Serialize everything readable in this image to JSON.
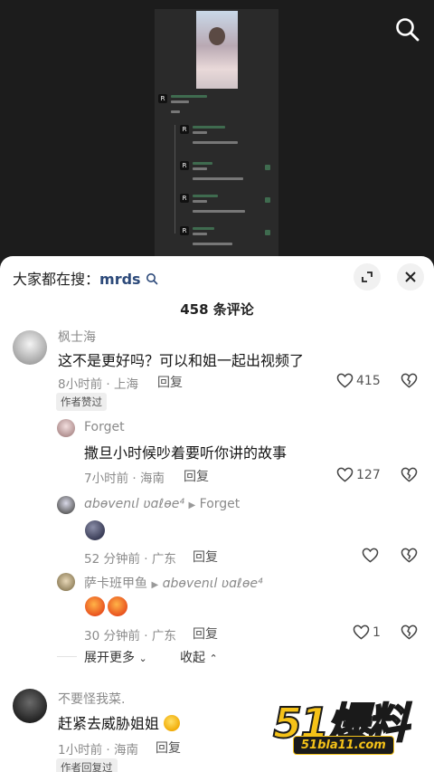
{
  "header": {
    "search_hint_prefix": "大家都在搜：",
    "search_hint_term": "mrds",
    "comment_count": "458 条评论"
  },
  "comments": [
    {
      "user": "枫士海",
      "text": "这不是更好吗？可以和姐一起出视频了",
      "time_loc": "8小时前 · 上海",
      "reply_label": "回复",
      "likes": "415",
      "badge": "作者赞过"
    },
    {
      "user": "Forget",
      "text": "撒旦小时候吵着要听你讲的故事",
      "time_loc": "7小时前 · 海南",
      "reply_label": "回复",
      "likes": "127"
    },
    {
      "user": "ɑbѳvenιl ʋɑℓѳe⁴",
      "reply_to": "Forget",
      "time_loc": "52 分钟前 · 广东",
      "reply_label": "回复",
      "likes": ""
    },
    {
      "user": "萨卡班甲鱼",
      "reply_to": "ɑbѳvenιl ʋɑℓѳe⁴",
      "time_loc": "30 分钟前 · 广东",
      "reply_label": "回复",
      "likes": "1"
    },
    {
      "user": "不要怪我菜.",
      "text": "赶紧去威胁姐姐",
      "time_loc": "1小时前 · 海南",
      "reply_label": "回复",
      "badge": "作者回复过"
    }
  ],
  "thread_controls": {
    "expand_label": "展开更多",
    "collapse_label": "收起"
  },
  "watermark": {
    "big_text": "51爆料",
    "url_text": "51bla11.com"
  },
  "icons": [
    "search-icon",
    "expand-icon",
    "close-icon",
    "heart-icon",
    "broken-heart-icon",
    "triangle-right-icon",
    "chevron-down-icon",
    "chevron-up-icon"
  ],
  "colors": {
    "search_term": "#2d4a7a",
    "watermark_yellow": "#f5c218",
    "sheet_bg": "#ffffff",
    "video_bg": "#1c1c1c"
  }
}
